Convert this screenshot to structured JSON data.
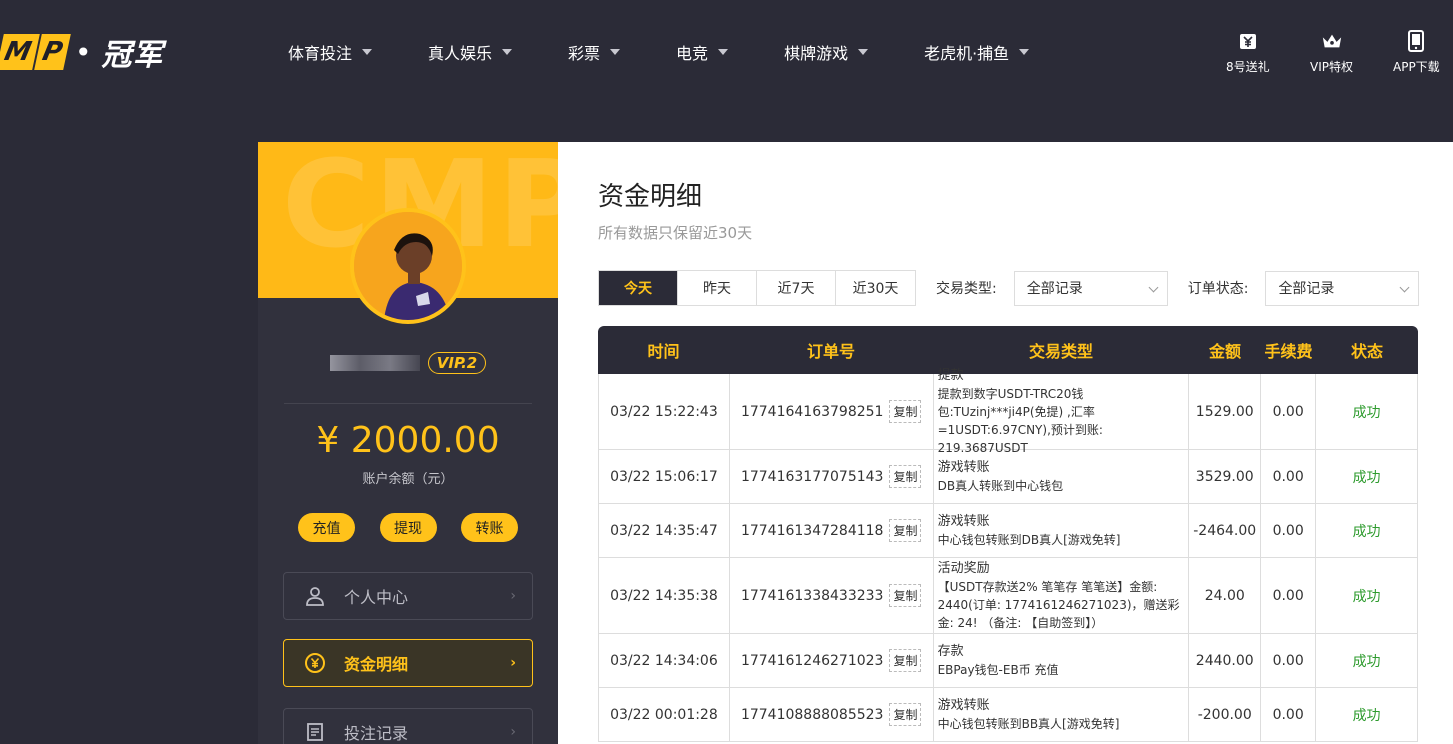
{
  "header": {
    "logo_left": [
      "M",
      "P"
    ],
    "logo_text": "冠军",
    "nav": [
      {
        "label": "体育投注"
      },
      {
        "label": "真人娱乐"
      },
      {
        "label": "彩票"
      },
      {
        "label": "电竞"
      },
      {
        "label": "棋牌游戏"
      },
      {
        "label": "老虎机·捕鱼"
      }
    ],
    "quick": [
      {
        "label": "8号送礼",
        "icon": "gift-yen-icon"
      },
      {
        "label": "VIP特权",
        "icon": "crown-icon"
      },
      {
        "label": "APP下载",
        "icon": "phone-icon"
      }
    ]
  },
  "sidebar": {
    "watermark": "CMP",
    "vip": "VIP.2",
    "balance": "¥ 2000.00",
    "balance_label": "账户余额（元）",
    "actions": [
      "充值",
      "提现",
      "转账"
    ],
    "menu": [
      {
        "label": "个人中心",
        "icon": "user-icon",
        "active": false
      },
      {
        "label": "资金明细",
        "icon": "yen-circle-icon",
        "active": true
      },
      {
        "label": "投注记录",
        "icon": "document-icon",
        "active": false
      }
    ]
  },
  "main": {
    "title": "资金明细",
    "subtitle": "所有数据只保留近30天",
    "ranges": [
      "今天",
      "昨天",
      "近7天",
      "近30天"
    ],
    "active_range": "今天",
    "type_label": "交易类型:",
    "type_value": "全部记录",
    "status_label": "订单状态:",
    "status_value": "全部记录",
    "columns": [
      "时间",
      "订单号",
      "交易类型",
      "金额",
      "手续费",
      "状态"
    ],
    "copy_label": "复制",
    "rows": [
      {
        "time": "03/22 15:22:43",
        "order": "1774164163798251",
        "type": "提款",
        "detail": "提款到数字USDT-TRC20钱包:TUzinj***ji4P(免提) ,汇率=1USDT:6.97CNY),预计到账: 219.3687USDT",
        "amount": "1529.00",
        "fee": "0.00",
        "status": "成功"
      },
      {
        "time": "03/22 15:06:17",
        "order": "1774163177075143",
        "type": "游戏转账",
        "detail": "DB真人转账到中心钱包",
        "amount": "3529.00",
        "fee": "0.00",
        "status": "成功"
      },
      {
        "time": "03/22 14:35:47",
        "order": "1774161347284118",
        "type": "游戏转账",
        "detail": "中心钱包转账到DB真人[游戏免转]",
        "amount": "-2464.00",
        "fee": "0.00",
        "status": "成功"
      },
      {
        "time": "03/22 14:35:38",
        "order": "1774161338433233",
        "type": "活动奖励",
        "detail": "【USDT存款送2% 笔笔存 笔笔送】金额: 2440(订单: 1774161246271023)，赠送彩金: 24! （备注: 【自助签到】）",
        "amount": "24.00",
        "fee": "0.00",
        "status": "成功"
      },
      {
        "time": "03/22 14:34:06",
        "order": "1774161246271023",
        "type": "存款",
        "detail": "EBPay钱包-EB币 充值",
        "amount": "2440.00",
        "fee": "0.00",
        "status": "成功"
      },
      {
        "time": "03/22 00:01:28",
        "order": "1774108888085523",
        "type": "游戏转账",
        "detail": "中心钱包转账到BB真人[游戏免转]",
        "amount": "-200.00",
        "fee": "0.00",
        "status": "成功"
      }
    ]
  }
}
